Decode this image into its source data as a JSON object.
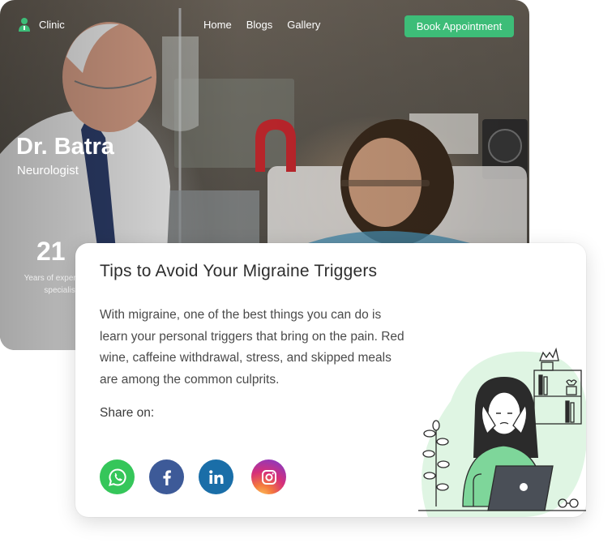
{
  "nav": {
    "brand": "Clinic",
    "links": [
      "Home",
      "Blogs",
      "Gallery"
    ],
    "cta": "Book Appointment"
  },
  "hero": {
    "doctor_name": "Dr. Batra",
    "specialty": "Neurologist",
    "stat_value": "21",
    "stat_label": "Years of experti as a specialist"
  },
  "article": {
    "title": "Tips to Avoid Your Migraine Triggers",
    "body": "With migraine, one of the best things you can do is learn your personal triggers that bring on the pain. Red wine, caffeine withdrawal, stress, and skipped meals are among the common culprits.",
    "share_label": "Share on:",
    "social": [
      "whatsapp-icon",
      "facebook-icon",
      "linkedin-icon",
      "instagram-icon"
    ]
  },
  "colors": {
    "accent": "#3dbd78",
    "whatsapp": "#35c65a",
    "facebook": "#3d5a98",
    "linkedin": "#1a6ea8",
    "illustration_blob": "#dff5e3"
  }
}
